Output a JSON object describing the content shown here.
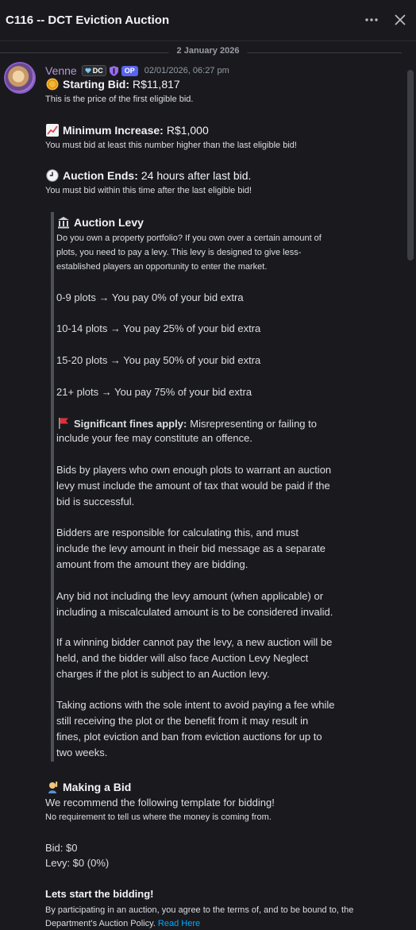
{
  "header": {
    "title": "C116 -- DCT Eviction Auction"
  },
  "date_divider": "2 January 2026",
  "message": {
    "author": "Venne",
    "badge_dc": "DC",
    "badge_op": "OP",
    "timestamp": "02/01/2026, 06:27 pm",
    "starting_bid": {
      "label": "Starting Bid:",
      "value": "R$11,817",
      "note": "This is the price of the first eligible bid."
    },
    "min_increase": {
      "label": "Minimum Increase:",
      "value": "R$1,000",
      "note": "You must bid at least this number higher than the last eligible bid!"
    },
    "auction_ends": {
      "label": "Auction Ends:",
      "value": "24 hours after last bid.",
      "note": "You must bid within this time after the last eligible bid!"
    },
    "levy": {
      "title": "Auction Levy",
      "intro": [
        "Do you own a property portfolio? If you own over a certain amount of",
        "plots, you need to pay a levy. This levy is designed to give less-",
        "established players an opportunity to enter the market."
      ],
      "tiers": [
        "0-9 plots → You pay 0% of your bid extra",
        "10-14 plots → You pay 25% of your bid extra",
        "15-20 plots → You pay 50% of your bid extra",
        "21+ plots → You pay 75% of your bid extra"
      ],
      "fines_label": "Significant fines apply:",
      "fines_rest": "Misrepresenting or failing to",
      "fines_line2": "include your fee may constitute an offence.",
      "para1": [
        "Bids by players who own enough plots to warrant an auction",
        "levy must include the amount of tax that would be paid if the",
        "bid is successful."
      ],
      "para2": [
        "Bidders are responsible for calculating this, and must",
        "include the levy amount in their bid message as a separate",
        "amount from the amount they are bidding."
      ],
      "para3": [
        "Any bid not including the levy amount (when applicable) or",
        "including a miscalculated amount is to be considered invalid."
      ],
      "para4": [
        "If a winning bidder cannot pay the levy, a new auction will be",
        "held, and the bidder will also face Auction Levy Neglect",
        "charges if the plot is subject to an Auction levy."
      ],
      "para5": [
        "Taking actions with the sole intent to avoid paying a fee while",
        "still receiving the plot or the benefit from it may result in",
        "fines, plot eviction and ban from eviction auctions for up to",
        "two weeks."
      ]
    },
    "making_bid": {
      "title": "Making a Bid",
      "recommend": "We recommend the following template for bidding!",
      "note": "No requirement to tell us where the money is coming from.",
      "bid_line": "Bid: $0",
      "levy_line": "Levy: $0 (0%)"
    },
    "closing": {
      "title": "Lets start the bidding!",
      "line1": "By participating in an auction, you agree to the terms of, and to be bound to, the",
      "line2": "Department's Auction Policy.",
      "link": "Read Here"
    }
  },
  "icons": {
    "starting_bid": "coin-icon",
    "min_increase": "chart-up-icon",
    "auction_ends": "clock-icon",
    "levy": "bank-icon",
    "fines": "red-flag-icon",
    "making_bid": "person-raising-hand-icon"
  },
  "colors": {
    "background": "#1a1a1e",
    "username": "#b39ad8",
    "link": "#00a8fc",
    "op_badge": "#5865f2"
  }
}
